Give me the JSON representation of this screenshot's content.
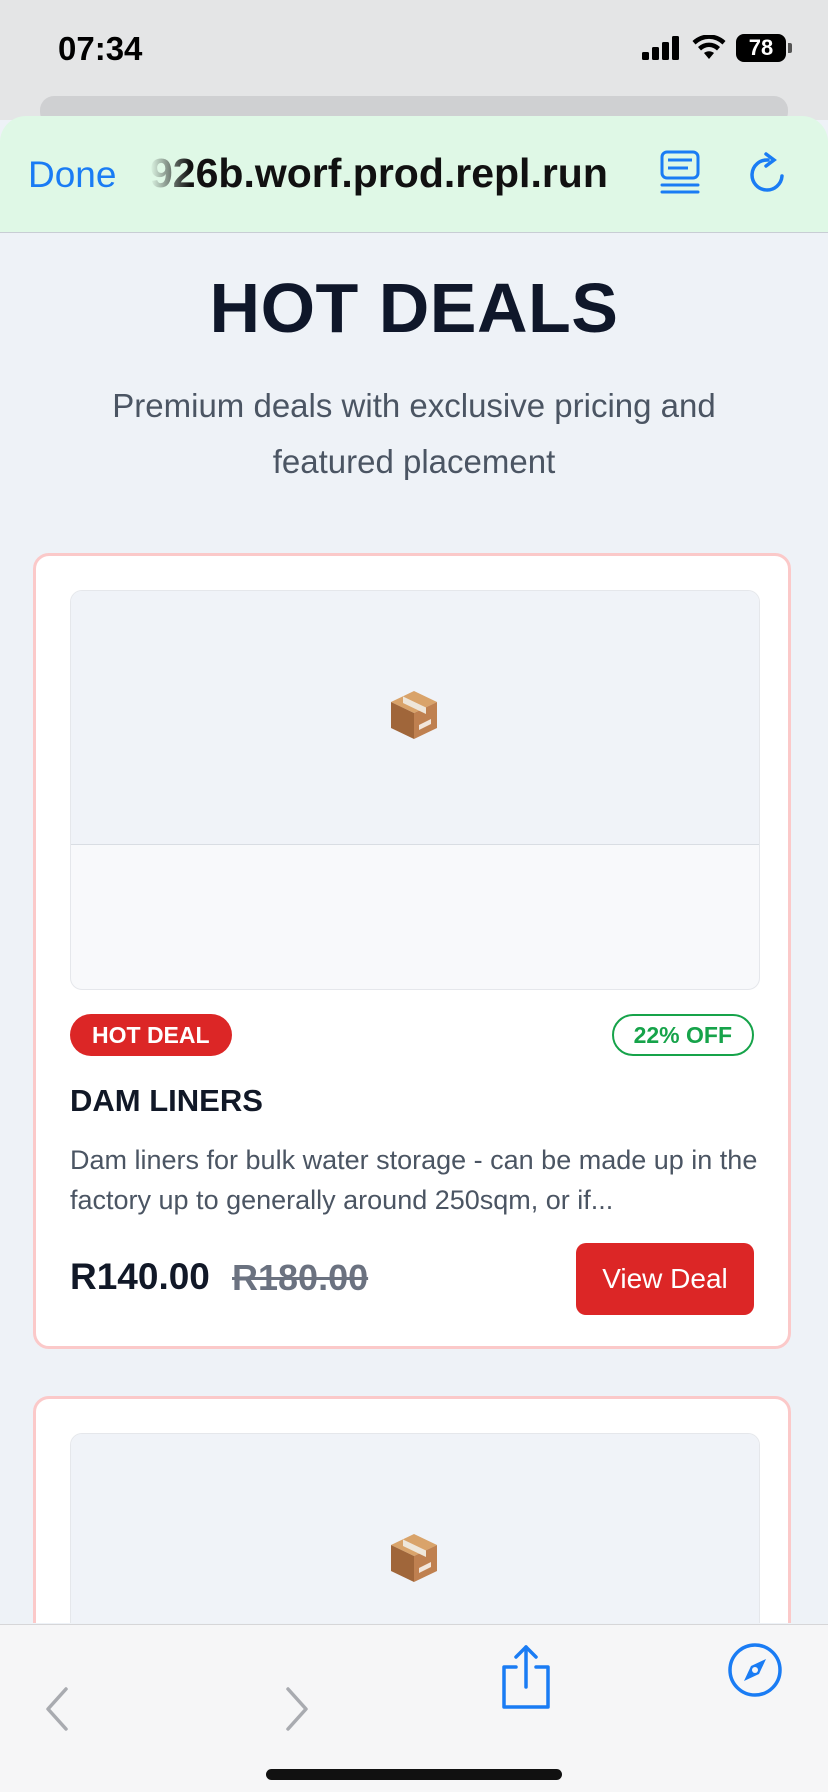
{
  "status_bar": {
    "time": "07:34",
    "battery": "78",
    "icons": [
      "signal-icon",
      "wifi-icon",
      "battery-icon"
    ]
  },
  "browser": {
    "done_label": "Done",
    "url": "926b.worf.prod.repl.run",
    "icons": [
      "reader-icon",
      "reload-icon"
    ],
    "accent_color": "#1a7cf4"
  },
  "page": {
    "title": "HOT DEALS",
    "subtitle": "Premium deals with exclusive pricing and featured placement"
  },
  "deals": [
    {
      "image_icon": "package-icon",
      "badge": "HOT DEAL",
      "discount": "22% OFF",
      "name": "DAM LINERS",
      "description": "Dam liners for bulk water storage - can be made up in the factory up to generally around 250sqm, or if...",
      "price": "R140.00",
      "old_price": "R180.00",
      "button_label": "View Deal"
    },
    {
      "image_icon": "package-icon"
    }
  ],
  "bottom_toolbar": {
    "icons": [
      "back-icon",
      "forward-icon",
      "share-icon",
      "compass-icon"
    ]
  },
  "colors": {
    "hot_red": "#dc2626",
    "discount_green": "#16a34a",
    "card_border": "#fbc9c9"
  }
}
